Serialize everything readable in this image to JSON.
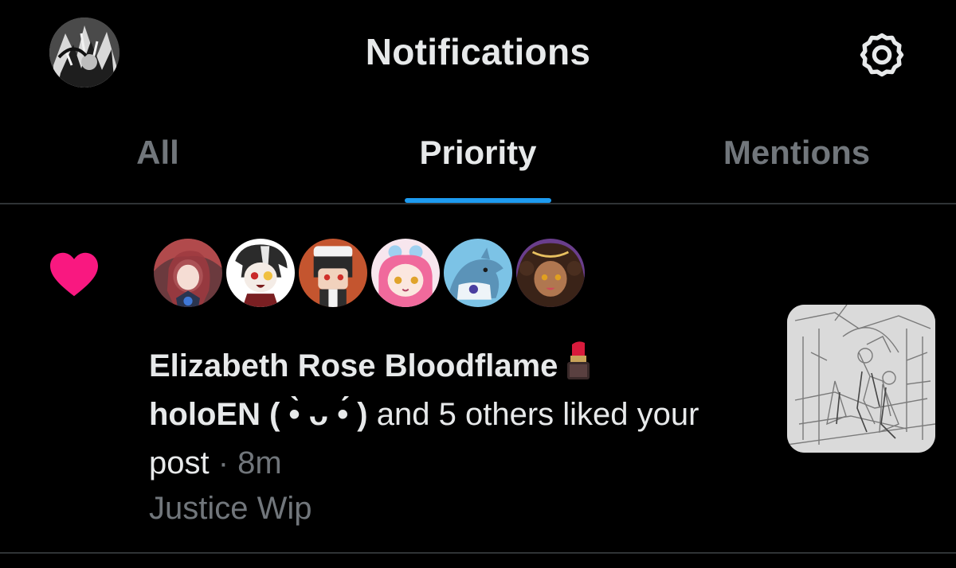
{
  "header": {
    "title": "Notifications",
    "profile_avatar_icon": "profile-avatar-image",
    "settings_icon": "gear-icon"
  },
  "tabs": [
    {
      "label": "All",
      "active": false
    },
    {
      "label": "Priority",
      "active": true
    },
    {
      "label": "Mentions",
      "active": false
    }
  ],
  "colors": {
    "background": "#000000",
    "text_primary": "#e7e9ea",
    "text_secondary": "#71767b",
    "accent": "#1d9bf0",
    "like": "#f91880",
    "divider": "#2f3336"
  },
  "notification": {
    "type_icon": "heart-icon",
    "liker_avatars": [
      {
        "icon": "avatar-red-hair"
      },
      {
        "icon": "avatar-vampire"
      },
      {
        "icon": "avatar-maid"
      },
      {
        "icon": "avatar-pink-hair"
      },
      {
        "icon": "avatar-shark"
      },
      {
        "icon": "avatar-curly-hair"
      }
    ],
    "first_user": "Elizabeth Rose Bloodflame",
    "first_user_emoji_icon": "lipstick-icon",
    "second_user": "holoEN (  •̀ ᴗ •́ )",
    "action_text": " and 5 others liked your post",
    "separator": " · ",
    "time": "8m",
    "post_title": "Justice Wip",
    "thumbnail_icon": "sketch-thumbnail"
  }
}
